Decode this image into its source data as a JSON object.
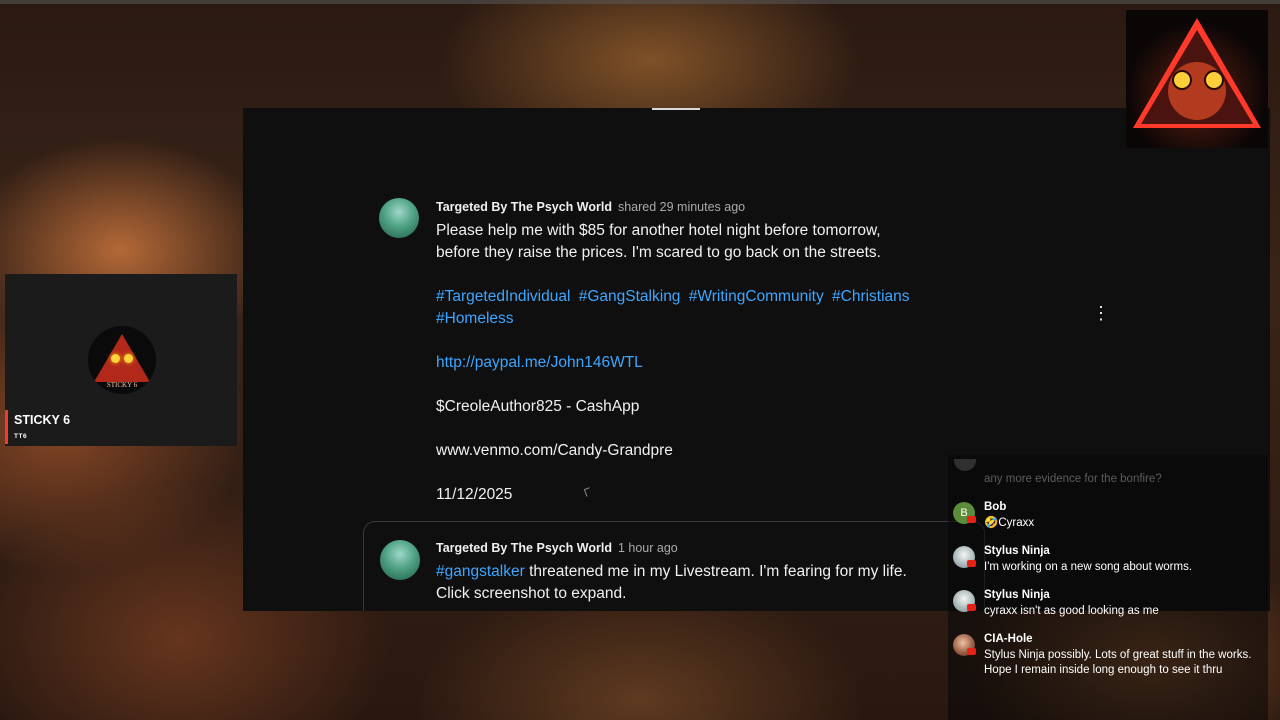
{
  "post": {
    "author": "Targeted By The Psych World",
    "meta": "shared 29 minutes ago",
    "body_line1": "Please help me with $85 for another hotel night before tomorrow,",
    "body_line2": "before they raise the prices. I'm scared to go back on the streets.",
    "hashtags": [
      "#TargetedIndividual",
      "#GangStalking",
      "#WritingCommunity",
      "#Christians",
      "#Homeless"
    ],
    "paypal": "http://paypal.me/John146WTL",
    "cashapp": "$CreoleAuthor825 - CashApp",
    "venmo": "www.venmo.com/Candy-Grandpre",
    "date": "11/12/2025",
    "more_icon": "⋮"
  },
  "post2": {
    "author": "Targeted By The Psych World",
    "meta": "1 hour ago",
    "hashtag": "#gangstalker",
    "body_rest": " threatened me in my Livestream. I'm fearing for my life.",
    "body_line2": "Click screenshot to expand."
  },
  "left_card": {
    "logo_text": "STICKY 6",
    "name": "STICKY 6",
    "sub": "TT6"
  },
  "chat": {
    "faded_text": "any more evidence for the bonfire?",
    "messages": [
      {
        "user": "Bob",
        "avatar_letter": "B",
        "text": "🤣Cyraxx"
      },
      {
        "user": "Stylus Ninja",
        "text": "I'm working on a new song about worms."
      },
      {
        "user": "Stylus Ninja",
        "text": "cyraxx isn't as good looking as me"
      },
      {
        "user": "CIA-Hole",
        "text": "Stylus Ninja possibly. Lots of great stuff in the works. Hope I remain inside long enough to see it thru"
      }
    ]
  },
  "colors": {
    "link": "#3ea6ff",
    "accent": "#e8402b",
    "panel_bg": "#0f0f0f"
  }
}
